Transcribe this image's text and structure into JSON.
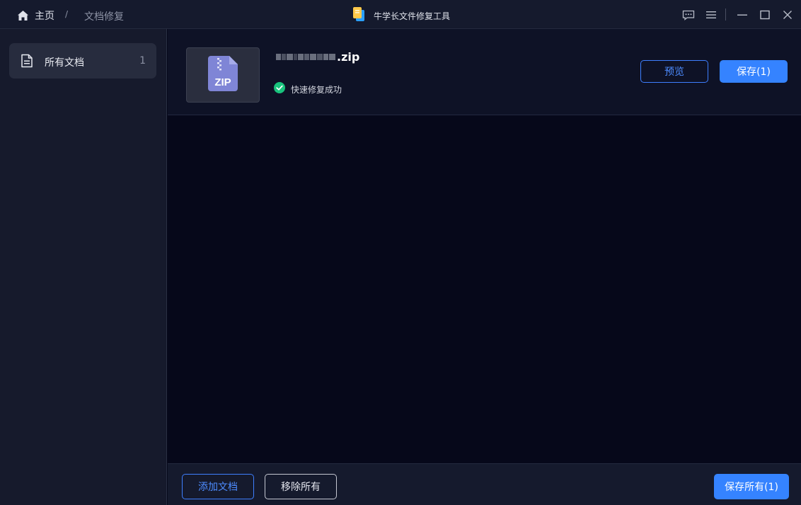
{
  "titlebar": {
    "home_label": "主页",
    "separator": "/",
    "current_page": "文档修复",
    "app_title": "牛学长文件修复工具",
    "controls": [
      "feedback-icon",
      "menu-icon",
      "minimize-icon",
      "maximize-icon",
      "close-icon"
    ]
  },
  "sidebar": {
    "items": [
      {
        "label": "所有文档",
        "count": "1",
        "icon": "document-icon"
      }
    ]
  },
  "file": {
    "name_ext": ".zip",
    "thumb_text": "ZIP",
    "status": "快速修复成功",
    "status_color": "#19c37d",
    "preview_label": "预览",
    "save_label": "保存(1)"
  },
  "footer": {
    "add_label": "添加文档",
    "remove_all_label": "移除所有",
    "save_all_label": "保存所有(1)"
  },
  "colors": {
    "accent": "#3583ff",
    "background": "#06081a",
    "panel": "#151a2d"
  }
}
